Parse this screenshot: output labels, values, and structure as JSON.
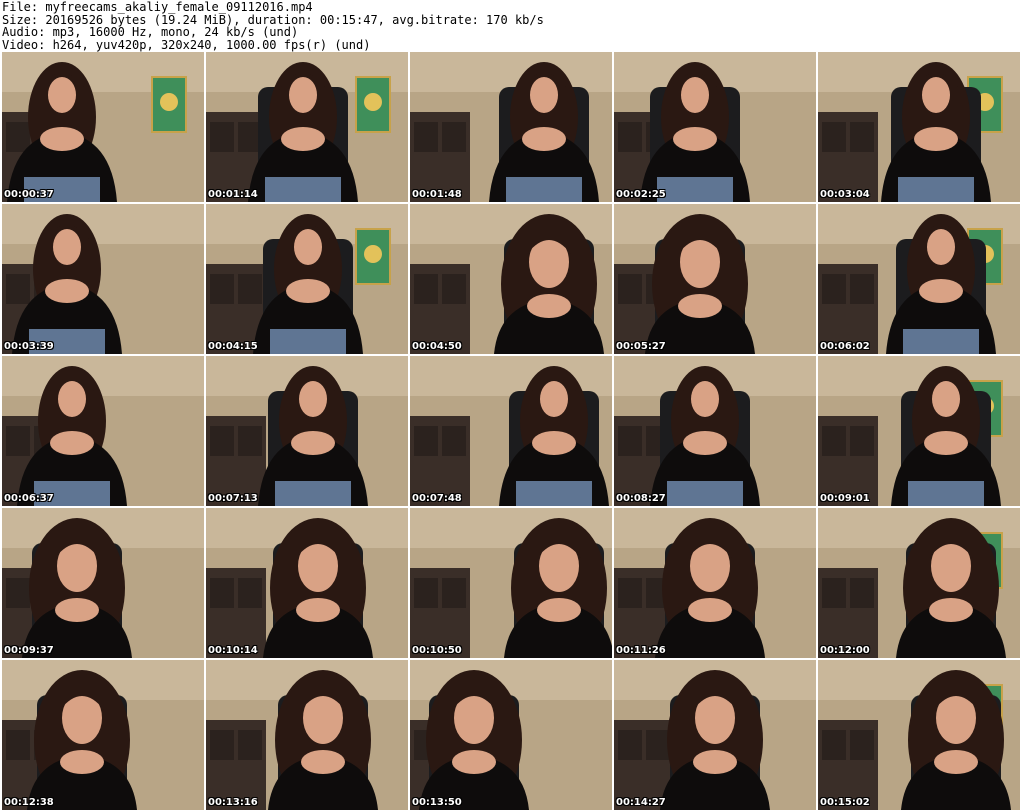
{
  "header": {
    "file_line": "File: myfreecams_akaliy_female_09112016.mp4",
    "size_line": "Size: 20169526 bytes (19.24 MiB), duration: 00:15:47, avg.bitrate: 170 kb/s",
    "audio_line": "Audio: mp3, 16000 Hz, mono, 24 kb/s (und)",
    "video_line": "Video: h264, yuv420p, 320x240, 1000.00 fps(r) (und)"
  },
  "thumbnails": [
    {
      "timestamp": "00:00:37"
    },
    {
      "timestamp": "00:01:14"
    },
    {
      "timestamp": "00:01:48"
    },
    {
      "timestamp": "00:02:25"
    },
    {
      "timestamp": "00:03:04"
    },
    {
      "timestamp": "00:03:39"
    },
    {
      "timestamp": "00:04:15"
    },
    {
      "timestamp": "00:04:50"
    },
    {
      "timestamp": "00:05:27"
    },
    {
      "timestamp": "00:06:02"
    },
    {
      "timestamp": "00:06:37"
    },
    {
      "timestamp": "00:07:13"
    },
    {
      "timestamp": "00:07:48"
    },
    {
      "timestamp": "00:08:27"
    },
    {
      "timestamp": "00:09:01"
    },
    {
      "timestamp": "00:09:37"
    },
    {
      "timestamp": "00:10:14"
    },
    {
      "timestamp": "00:10:50"
    },
    {
      "timestamp": "00:11:26"
    },
    {
      "timestamp": "00:12:00"
    },
    {
      "timestamp": "00:12:38"
    },
    {
      "timestamp": "00:13:16"
    },
    {
      "timestamp": "00:13:50"
    },
    {
      "timestamp": "00:14:27"
    },
    {
      "timestamp": "00:15:02"
    }
  ],
  "colors": {
    "wall": "#b8a586",
    "cabinet": "#3a2e28",
    "hair": "#2a1812",
    "top": "#0e0c0c",
    "skin": "#d9a285",
    "jeans": "#5f7593",
    "chair": "#1c1c1e",
    "painting": "#3f8f5a"
  }
}
